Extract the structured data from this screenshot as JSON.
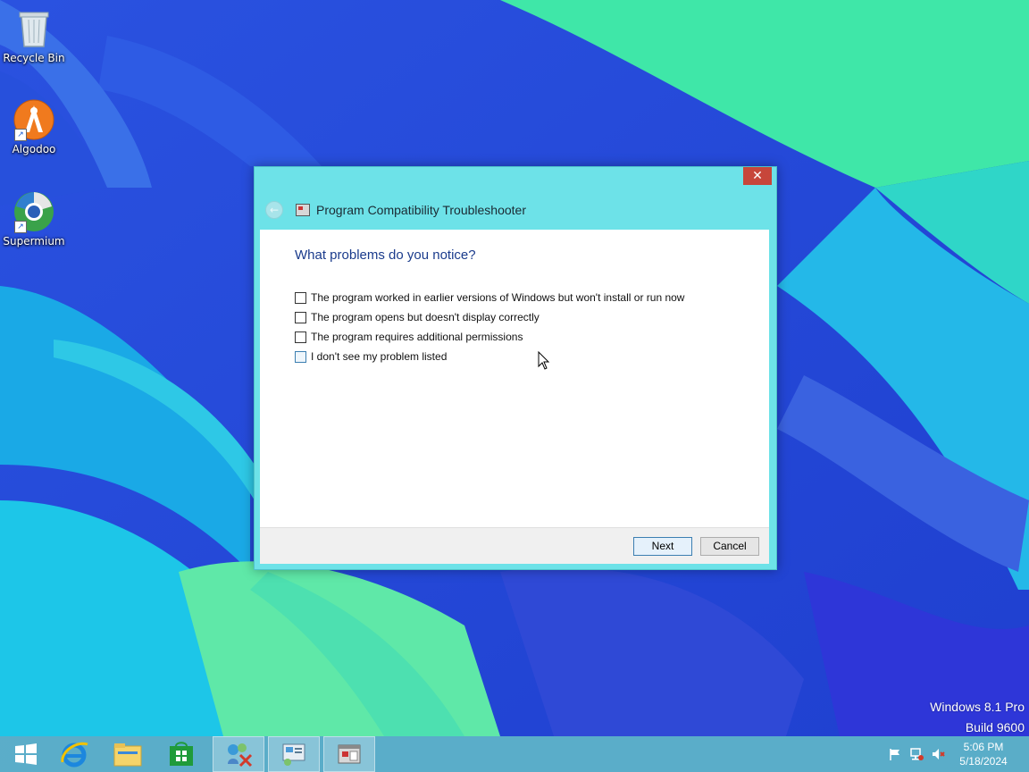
{
  "desktop": {
    "icons": [
      {
        "label": "Recycle Bin",
        "icon": "recycle-bin-icon"
      },
      {
        "label": "Algodoo",
        "icon": "algodoo-icon"
      },
      {
        "label": "Supermium",
        "icon": "supermium-icon"
      }
    ],
    "watermark": {
      "line1": "Windows 8.1 Pro",
      "line2": "Build 9600"
    }
  },
  "dialog": {
    "title": "Program Compatibility Troubleshooter",
    "close_glyph": "✕",
    "back_glyph": "←",
    "question": "What problems do you notice?",
    "options": [
      {
        "label": "The program worked in earlier versions of Windows but won't install or run now",
        "checked": false
      },
      {
        "label": "The program opens but doesn't display correctly",
        "checked": false
      },
      {
        "label": "The program requires additional permissions",
        "checked": false
      },
      {
        "label": "I don't see my problem listed",
        "checked": false
      }
    ],
    "buttons": {
      "next": "Next",
      "cancel": "Cancel"
    }
  },
  "taskbar": {
    "items": [
      "start-icon",
      "internet-explorer-icon",
      "file-explorer-icon",
      "store-icon",
      "network-troubleshooter-icon",
      "control-panel-icon",
      "compatibility-troubleshooter-icon"
    ],
    "clock": {
      "time": "5:06 PM",
      "date": "5/18/2024"
    }
  },
  "colors": {
    "dialog_frame": "#6de2e8",
    "close_button": "#c7463a",
    "question_text": "#1a3b8c",
    "taskbar": "#60b6c8"
  }
}
